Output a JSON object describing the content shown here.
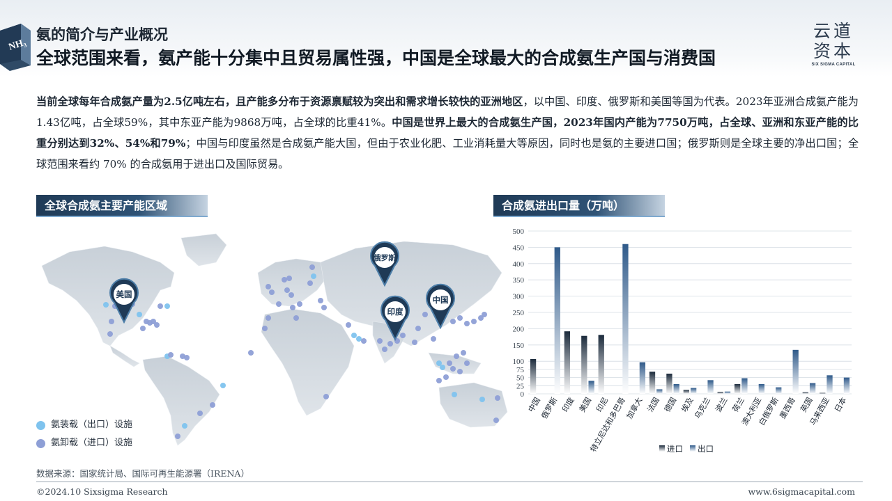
{
  "header": {
    "kicker": "氨的简介与产业概况",
    "headline": "全球范围来看，氨产能十分集中且贸易属性强，中国是全球最大的合成氨生产国与消费国",
    "badge": "NH₃"
  },
  "logo": {
    "line1": "云道",
    "line2": "资本",
    "line3": "SIX SIGMA CAPITAL"
  },
  "paragraph": {
    "s1": "当前全球每年合成氨产量为2.5亿吨左右，且产能多分布于资源禀赋较为突出和需求增长较快的亚洲地区",
    "s2": "，以中国、印度、俄罗斯和美国等国为代表。2023年亚洲合成氨产能为1.43亿吨，占全球59%，其中东亚产能为9868万吨，占全球的比重41%。",
    "s3": "中国是世界上最大的合成氨生产国，2023年国内产能为7750万吨，占全球、亚洲和东亚产能的比重分别达到32%、54%和79%",
    "s4": "；中国与印度虽然是合成氨产能大国，但由于农业化肥、工业消耗量大等原因，同时也是氨的主要进口国；俄罗斯则是全球主要的净出口国；全球范围来看约 70% 的合成氨用于进出口及国际贸易。"
  },
  "map_section": {
    "title": "全球合成氨主要产能区域",
    "pins": [
      "美国",
      "俄罗斯",
      "印度",
      "中国"
    ],
    "legend": [
      {
        "label": "氨装载（出口）设施",
        "color": "#7fc3ee"
      },
      {
        "label": "氨卸载（进口）设施",
        "color": "#8e9fd6"
      }
    ]
  },
  "chart_section": {
    "title": "合成氨进出口量（万吨）"
  },
  "chart_data": {
    "type": "bar",
    "categories": [
      "中国",
      "俄罗斯",
      "印度",
      "美国",
      "印尼",
      "特立尼达和多巴哥",
      "加拿大",
      "法国",
      "德国",
      "埃及",
      "乌克兰",
      "波兰",
      "荷兰",
      "澳大利亚",
      "白俄罗斯",
      "墨西哥",
      "英国",
      "马来西亚",
      "日本"
    ],
    "series": [
      {
        "name": "进口",
        "values": [
          107,
          0,
          192,
          178,
          181,
          0,
          0,
          68,
          62,
          12,
          0,
          6,
          30,
          0,
          0,
          0,
          5,
          3,
          0
        ]
      },
      {
        "name": "出口",
        "values": [
          0,
          450,
          0,
          40,
          0,
          460,
          97,
          14,
          30,
          18,
          42,
          7,
          48,
          30,
          20,
          135,
          33,
          57,
          50
        ]
      }
    ],
    "ylim": [
      0,
      500
    ],
    "yticks": [
      0,
      25,
      50,
      75,
      100,
      150,
      200,
      250,
      300,
      350,
      400,
      450,
      500
    ],
    "ytick_labels": [
      "0",
      "25",
      "50",
      "75",
      "100",
      "150",
      "200",
      "250",
      "300",
      "350",
      "400",
      "450",
      "500"
    ],
    "grid": true,
    "legend_position": "bottom",
    "colors": {
      "import": "#1c2b3c",
      "export": "#2f5a8a"
    }
  },
  "footer": {
    "source": "数据来源：国家统计局、国际可再生能源署（IRENA）",
    "copyright": "©2024.10 Sixsigma Research",
    "website": "www.6sigmacapital.com"
  },
  "watermark": "云道资本"
}
